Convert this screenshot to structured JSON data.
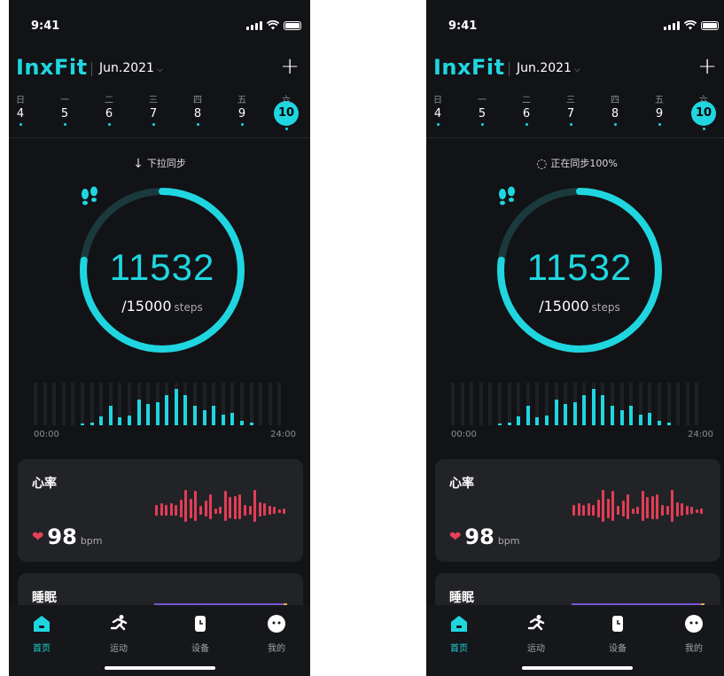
{
  "screens": [
    {
      "status_time": "9:41",
      "brand": "InxFit",
      "month": "Jun.2021",
      "week_labels": [
        "日",
        "一",
        "二",
        "三",
        "四",
        "五",
        "六"
      ],
      "week_days": [
        "4",
        "5",
        "6",
        "7",
        "8",
        "9",
        "10"
      ],
      "selected_day": "10",
      "sync_icon": "down-arrow-icon",
      "sync_text": "下拉同步",
      "steps": "11532",
      "goal": "/15000",
      "goal_unit": "steps",
      "progress": 0.77,
      "axis_start": "00:00",
      "axis_end": "24:00",
      "heart_title": "心率",
      "heart_value": "98",
      "heart_unit": "bpm",
      "sleep_title": "睡眠",
      "tabs": [
        "首页",
        "运动",
        "设备",
        "我的"
      ]
    },
    {
      "status_time": "9:41",
      "brand": "InxFit",
      "month": "Jun.2021",
      "week_labels": [
        "日",
        "一",
        "二",
        "三",
        "四",
        "五",
        "六"
      ],
      "week_days": [
        "4",
        "5",
        "6",
        "7",
        "8",
        "9",
        "10"
      ],
      "selected_day": "10",
      "sync_icon": "loading-spinner-icon",
      "sync_text": "正在同步100%",
      "steps": "11532",
      "goal": "/15000",
      "goal_unit": "steps",
      "progress": 0.77,
      "axis_start": "00:00",
      "axis_end": "24:00",
      "heart_title": "心率",
      "heart_value": "98",
      "heart_unit": "bpm",
      "sleep_title": "睡眠",
      "tabs": [
        "首页",
        "运动",
        "设备",
        "我的"
      ]
    }
  ],
  "step_bars": [
    0,
    0,
    0,
    0,
    0,
    0.05,
    0.06,
    0.2,
    0.45,
    0.18,
    0.22,
    0.6,
    0.5,
    0.55,
    0.7,
    0.85,
    0.7,
    0.45,
    0.35,
    0.45,
    0.25,
    0.3,
    0.1,
    0.06,
    0,
    0,
    0
  ],
  "heart_bars": [
    0.3,
    0.35,
    0.3,
    0.35,
    0.3,
    0.5,
    0.9,
    0.55,
    0.85,
    0.25,
    0.45,
    0.7,
    0.15,
    0.2,
    0.85,
    0.6,
    0.65,
    0.7,
    0.3,
    0.25,
    0.9,
    0.4,
    0.35,
    0.25,
    0.2,
    0.1,
    0.15
  ],
  "colors": {
    "accent": "#1fd6e0",
    "heart": "#e33d56",
    "sleep": "#7a55d8",
    "background": "#121316"
  }
}
